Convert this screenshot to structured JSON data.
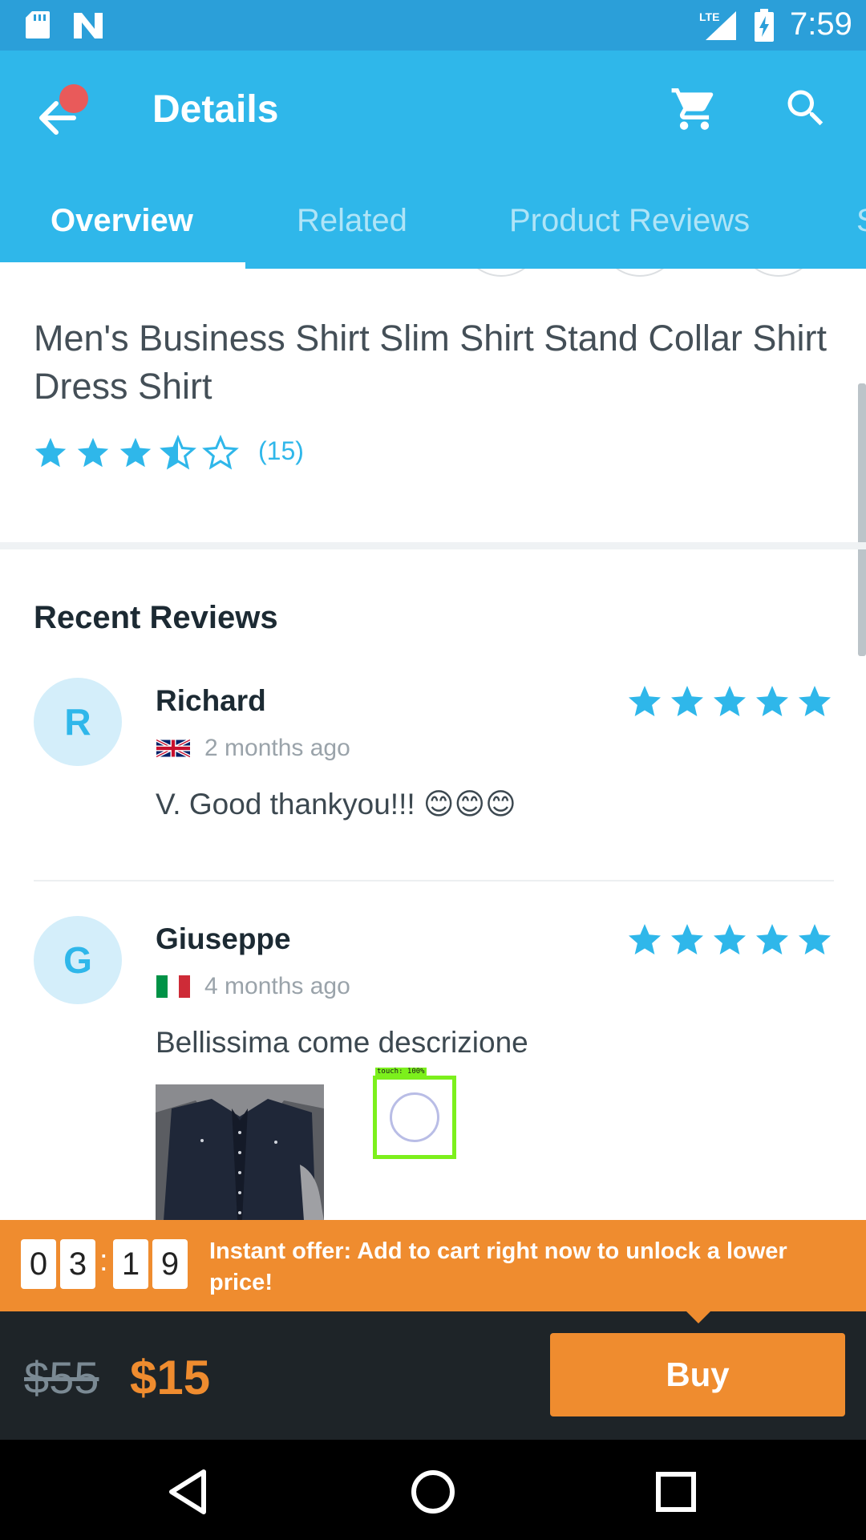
{
  "status_bar": {
    "time": "7:59",
    "network": "LTE",
    "icons": [
      "sd-card-icon",
      "n-icon",
      "lte-signal-icon",
      "battery-charging-icon"
    ]
  },
  "toolbar": {
    "title": "Details",
    "back_icon": "back-arrow-icon",
    "cart_icon": "cart-icon",
    "search_icon": "search-icon",
    "notification_color": "#e95a5a"
  },
  "tabs": [
    {
      "label": "Overview",
      "active": true
    },
    {
      "label": "Related",
      "active": false
    },
    {
      "label": "Product Reviews",
      "active": false
    },
    {
      "label": "S",
      "active": false
    }
  ],
  "product": {
    "title": "Men's Business Shirt Slim Shirt Stand Collar Shirt Dress Shirt",
    "rating": 3.5,
    "rating_count": "(15)"
  },
  "recent_reviews": {
    "title": "Recent Reviews",
    "reviews": [
      {
        "initial": "R",
        "name": "Richard",
        "flag": "uk-flag-icon",
        "date": "2 months ago",
        "text": "V. Good thankyou!!! 😊😊😊",
        "stars": 5
      },
      {
        "initial": "G",
        "name": "Giuseppe",
        "flag": "italy-flag-icon",
        "date": "4 months ago",
        "text": "Bellissima come descrizione",
        "stars": 5
      }
    ]
  },
  "touch_overlay": {
    "label": "touch: 100%"
  },
  "offer": {
    "timer_digits": [
      "0",
      "3",
      "1",
      "9"
    ],
    "separator": ":",
    "text": "Instant offer: Add to cart right now to unlock a lower price!"
  },
  "purchase": {
    "old_price": "$55",
    "new_price": "$15",
    "buy_label": "Buy"
  },
  "nav_bar": {
    "icons": [
      "back-triangle-icon",
      "home-circle-icon",
      "recents-square-icon"
    ]
  },
  "colors": {
    "primary": "#2fb7ea",
    "status_bar": "#2b9fd9",
    "accent": "#ef8c2f",
    "dark_bar": "#1e2428",
    "star": "#2fb7ea"
  }
}
